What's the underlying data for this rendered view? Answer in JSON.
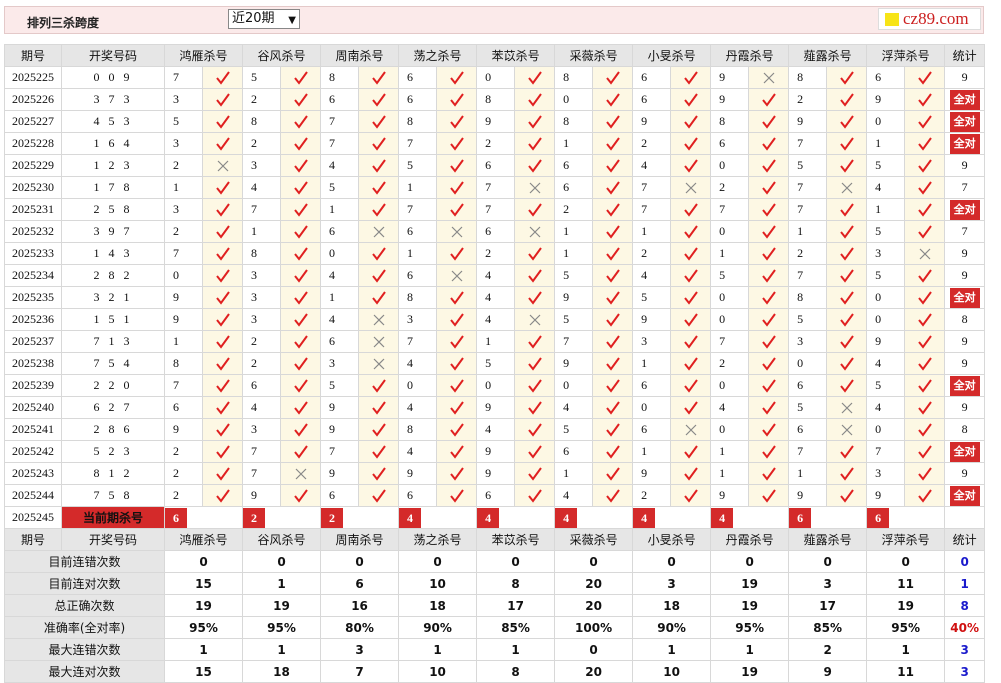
{
  "header": {
    "title": "排列三杀跨度",
    "period_selected": "近20期",
    "brand": "cz89.com"
  },
  "columns": {
    "issue": "期号",
    "draw": "开奖号码",
    "experts": [
      "鸿雁杀号",
      "谷风杀号",
      "周南杀号",
      "荡之杀号",
      "苯苡杀号",
      "采薇杀号",
      "小旻杀号",
      "丹霞杀号",
      "薤露杀号",
      "浮萍杀号"
    ],
    "stat": "统计"
  },
  "rows": [
    {
      "issue": "2025225",
      "draw": "0 0 9",
      "kills": [
        "7",
        "5",
        "8",
        "6",
        "0",
        "8",
        "6",
        "9",
        "8",
        "6"
      ],
      "ok": [
        1,
        1,
        1,
        1,
        1,
        1,
        1,
        0,
        1,
        1
      ],
      "stat": "9"
    },
    {
      "issue": "2025226",
      "draw": "3 7 3",
      "kills": [
        "3",
        "2",
        "6",
        "6",
        "8",
        "0",
        "6",
        "9",
        "2",
        "9"
      ],
      "ok": [
        1,
        1,
        1,
        1,
        1,
        1,
        1,
        1,
        1,
        1
      ],
      "stat": "全对"
    },
    {
      "issue": "2025227",
      "draw": "4 5 3",
      "kills": [
        "5",
        "8",
        "7",
        "8",
        "9",
        "8",
        "9",
        "8",
        "9",
        "0"
      ],
      "ok": [
        1,
        1,
        1,
        1,
        1,
        1,
        1,
        1,
        1,
        1
      ],
      "stat": "全对"
    },
    {
      "issue": "2025228",
      "draw": "1 6 4",
      "kills": [
        "3",
        "2",
        "7",
        "7",
        "2",
        "1",
        "2",
        "6",
        "7",
        "1"
      ],
      "ok": [
        1,
        1,
        1,
        1,
        1,
        1,
        1,
        1,
        1,
        1
      ],
      "stat": "全对"
    },
    {
      "issue": "2025229",
      "draw": "1 2 3",
      "kills": [
        "2",
        "3",
        "4",
        "5",
        "6",
        "6",
        "4",
        "0",
        "5",
        "5"
      ],
      "ok": [
        0,
        1,
        1,
        1,
        1,
        1,
        1,
        1,
        1,
        1
      ],
      "stat": "9"
    },
    {
      "issue": "2025230",
      "draw": "1 7 8",
      "kills": [
        "1",
        "4",
        "5",
        "1",
        "7",
        "6",
        "7",
        "2",
        "7",
        "4"
      ],
      "ok": [
        1,
        1,
        1,
        1,
        0,
        1,
        0,
        1,
        0,
        1
      ],
      "stat": "7"
    },
    {
      "issue": "2025231",
      "draw": "2 5 8",
      "kills": [
        "3",
        "7",
        "1",
        "7",
        "7",
        "2",
        "7",
        "7",
        "7",
        "1"
      ],
      "ok": [
        1,
        1,
        1,
        1,
        1,
        1,
        1,
        1,
        1,
        1
      ],
      "stat": "全对"
    },
    {
      "issue": "2025232",
      "draw": "3 9 7",
      "kills": [
        "2",
        "1",
        "6",
        "6",
        "6",
        "1",
        "1",
        "0",
        "1",
        "5"
      ],
      "ok": [
        1,
        1,
        0,
        0,
        0,
        1,
        1,
        1,
        1,
        1
      ],
      "stat": "7"
    },
    {
      "issue": "2025233",
      "draw": "1 4 3",
      "kills": [
        "7",
        "8",
        "0",
        "1",
        "2",
        "1",
        "2",
        "1",
        "2",
        "3"
      ],
      "ok": [
        1,
        1,
        1,
        1,
        1,
        1,
        1,
        1,
        1,
        0
      ],
      "stat": "9"
    },
    {
      "issue": "2025234",
      "draw": "2 8 2",
      "kills": [
        "0",
        "3",
        "4",
        "6",
        "4",
        "5",
        "4",
        "5",
        "7",
        "5"
      ],
      "ok": [
        1,
        1,
        1,
        0,
        1,
        1,
        1,
        1,
        1,
        1
      ],
      "stat": "9"
    },
    {
      "issue": "2025235",
      "draw": "3 2 1",
      "kills": [
        "9",
        "3",
        "1",
        "8",
        "4",
        "9",
        "5",
        "0",
        "8",
        "0"
      ],
      "ok": [
        1,
        1,
        1,
        1,
        1,
        1,
        1,
        1,
        1,
        1
      ],
      "stat": "全对"
    },
    {
      "issue": "2025236",
      "draw": "1 5 1",
      "kills": [
        "9",
        "3",
        "4",
        "3",
        "4",
        "5",
        "9",
        "0",
        "5",
        "0"
      ],
      "ok": [
        1,
        1,
        0,
        1,
        0,
        1,
        1,
        1,
        1,
        1
      ],
      "stat": "8"
    },
    {
      "issue": "2025237",
      "draw": "7 1 3",
      "kills": [
        "1",
        "2",
        "6",
        "7",
        "1",
        "7",
        "3",
        "7",
        "3",
        "9"
      ],
      "ok": [
        1,
        1,
        0,
        1,
        1,
        1,
        1,
        1,
        1,
        1
      ],
      "stat": "9"
    },
    {
      "issue": "2025238",
      "draw": "7 5 4",
      "kills": [
        "8",
        "2",
        "3",
        "4",
        "5",
        "9",
        "1",
        "2",
        "0",
        "4"
      ],
      "ok": [
        1,
        1,
        0,
        1,
        1,
        1,
        1,
        1,
        1,
        1
      ],
      "stat": "9"
    },
    {
      "issue": "2025239",
      "draw": "2 2 0",
      "kills": [
        "7",
        "6",
        "5",
        "0",
        "0",
        "0",
        "6",
        "0",
        "6",
        "5"
      ],
      "ok": [
        1,
        1,
        1,
        1,
        1,
        1,
        1,
        1,
        1,
        1
      ],
      "stat": "全对"
    },
    {
      "issue": "2025240",
      "draw": "6 2 7",
      "kills": [
        "6",
        "4",
        "9",
        "4",
        "9",
        "4",
        "0",
        "4",
        "5",
        "4"
      ],
      "ok": [
        1,
        1,
        1,
        1,
        1,
        1,
        1,
        1,
        0,
        1
      ],
      "stat": "9"
    },
    {
      "issue": "2025241",
      "draw": "2 8 6",
      "kills": [
        "9",
        "3",
        "9",
        "8",
        "4",
        "5",
        "6",
        "0",
        "6",
        "0"
      ],
      "ok": [
        1,
        1,
        1,
        1,
        1,
        1,
        0,
        1,
        0,
        1
      ],
      "stat": "8"
    },
    {
      "issue": "2025242",
      "draw": "5 2 3",
      "kills": [
        "2",
        "7",
        "7",
        "4",
        "9",
        "6",
        "1",
        "1",
        "7",
        "7"
      ],
      "ok": [
        1,
        1,
        1,
        1,
        1,
        1,
        1,
        1,
        1,
        1
      ],
      "stat": "全对"
    },
    {
      "issue": "2025243",
      "draw": "8 1 2",
      "kills": [
        "2",
        "7",
        "9",
        "9",
        "9",
        "1",
        "9",
        "1",
        "1",
        "3"
      ],
      "ok": [
        1,
        0,
        1,
        1,
        1,
        1,
        1,
        1,
        1,
        1
      ],
      "stat": "9"
    },
    {
      "issue": "2025244",
      "draw": "7 5 8",
      "kills": [
        "2",
        "9",
        "6",
        "6",
        "6",
        "4",
        "2",
        "9",
        "9",
        "9"
      ],
      "ok": [
        1,
        1,
        1,
        1,
        1,
        1,
        1,
        1,
        1,
        1
      ],
      "stat": "全对"
    }
  ],
  "current": {
    "issue": "2025245",
    "label": "当前期杀号",
    "kills": [
      "6",
      "2",
      "2",
      "4",
      "4",
      "4",
      "4",
      "4",
      "6",
      "6"
    ]
  },
  "summary": [
    {
      "label": "目前连错次数",
      "values": [
        "0",
        "0",
        "0",
        "0",
        "0",
        "0",
        "0",
        "0",
        "0",
        "0"
      ],
      "stat": "0",
      "red": false
    },
    {
      "label": "目前连对次数",
      "values": [
        "15",
        "1",
        "6",
        "10",
        "8",
        "20",
        "3",
        "19",
        "3",
        "11"
      ],
      "stat": "1",
      "red": false
    },
    {
      "label": "总正确次数",
      "values": [
        "19",
        "19",
        "16",
        "18",
        "17",
        "20",
        "18",
        "19",
        "17",
        "19"
      ],
      "stat": "8",
      "red": false
    },
    {
      "label": "准确率(全对率)",
      "values": [
        "95%",
        "95%",
        "80%",
        "90%",
        "85%",
        "100%",
        "90%",
        "95%",
        "85%",
        "95%"
      ],
      "stat": "40%",
      "red": true
    },
    {
      "label": "最大连错次数",
      "values": [
        "1",
        "1",
        "3",
        "1",
        "1",
        "0",
        "1",
        "1",
        "2",
        "1"
      ],
      "stat": "3",
      "red": false
    },
    {
      "label": "最大连对次数",
      "values": [
        "15",
        "18",
        "7",
        "10",
        "8",
        "20",
        "10",
        "19",
        "9",
        "11"
      ],
      "stat": "3",
      "red": false
    }
  ],
  "icons": {
    "correct": "check-mark-icon",
    "wrong": "cross-mark-icon"
  },
  "colors": {
    "accent_red": "#d42a2a",
    "check": "#e02020",
    "cross": "#888888",
    "blue": "#1a1acc"
  }
}
